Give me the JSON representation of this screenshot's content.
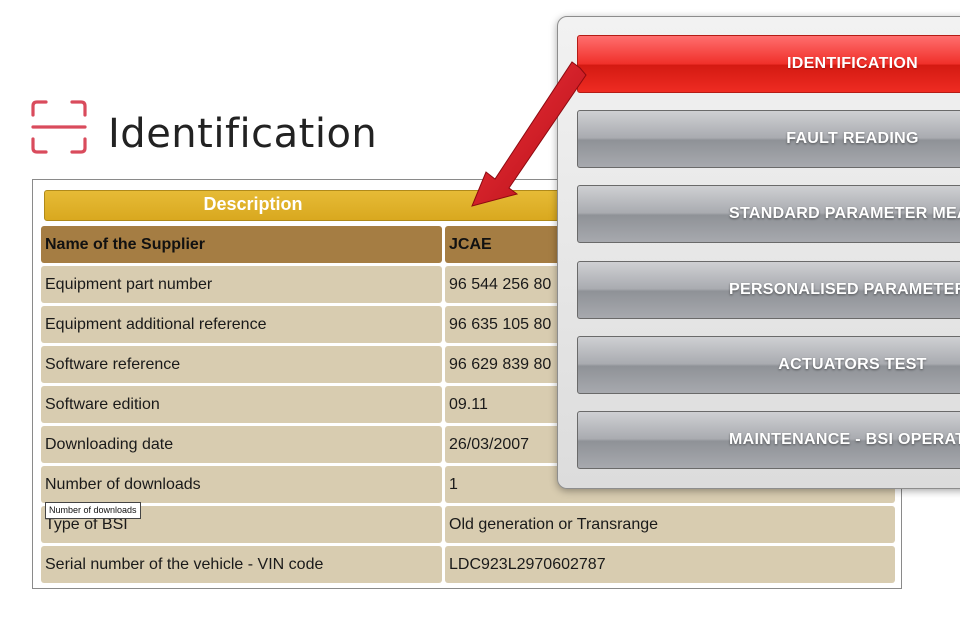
{
  "header": {
    "title": "Identification",
    "icon": "scan-frame-icon",
    "accent": "#d94b5c"
  },
  "table": {
    "description_label": "Description",
    "header_row": {
      "name": "Name of the Supplier",
      "value": "JCAE"
    },
    "rows": [
      {
        "name": "Equipment part number",
        "value": "96 544 256 80"
      },
      {
        "name": "Equipment additional reference",
        "value": "96 635 105 80"
      },
      {
        "name": "Software reference",
        "value": "96 629 839 80"
      },
      {
        "name": "Software edition",
        "value": "09.11"
      },
      {
        "name": "Downloading date",
        "value": "26/03/2007"
      },
      {
        "name": "Number of downloads",
        "value": "1"
      },
      {
        "name": "Type of BSI",
        "value": "Old generation or Transrange"
      },
      {
        "name": "Serial number of the vehicle - VIN code",
        "value": "LDC923L2970602787"
      }
    ],
    "colors": {
      "header": "#a57d43",
      "row": "#d8ccb0",
      "description_bar": "#e0b12a"
    }
  },
  "tooltip": {
    "text": "Number of downloads"
  },
  "menu": {
    "items": [
      {
        "label": "IDENTIFICATION",
        "active": true
      },
      {
        "label": "FAULT READING",
        "active": false
      },
      {
        "label": "STANDARD PARAMETER MEASUREMENT",
        "active": false
      },
      {
        "label": "PERSONALISED PARAMETER MEASUREMENT",
        "active": false
      },
      {
        "label": "ACTUATORS TEST",
        "active": false
      },
      {
        "label": "MAINTENANCE - BSI OPERATING",
        "active": false
      }
    ],
    "colors": {
      "active": "#e8231d",
      "inactive": "#a0a2a7"
    }
  },
  "annotation": {
    "icon": "red-pointer-arrow-icon",
    "color": "#d0151f"
  }
}
